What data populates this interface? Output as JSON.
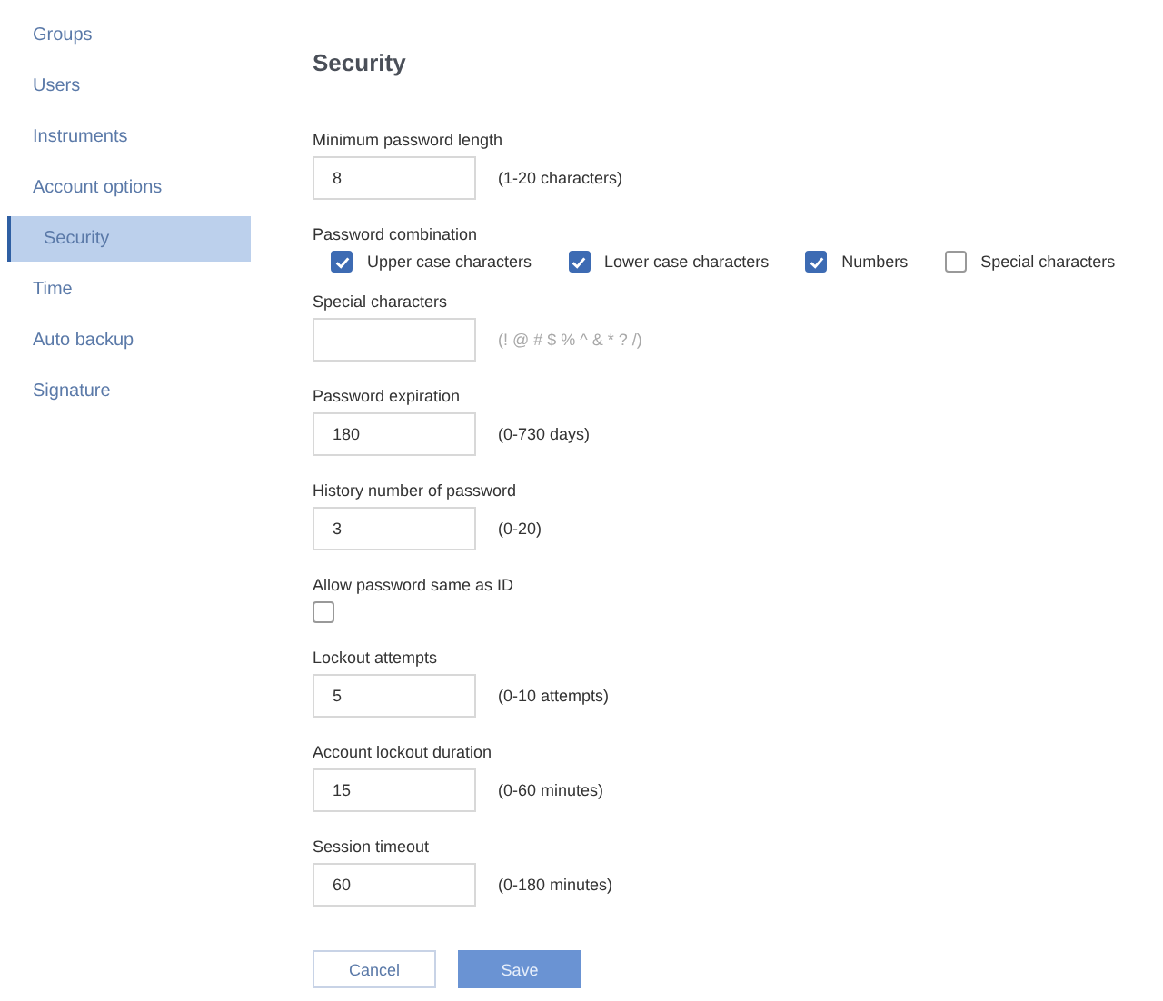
{
  "sidebar": {
    "items": [
      {
        "label": "Groups",
        "selected": false
      },
      {
        "label": "Users",
        "selected": false
      },
      {
        "label": "Instruments",
        "selected": false
      },
      {
        "label": "Account options",
        "selected": false
      },
      {
        "label": "Security",
        "selected": true
      },
      {
        "label": "Time",
        "selected": false
      },
      {
        "label": "Auto backup",
        "selected": false
      },
      {
        "label": "Signature",
        "selected": false
      }
    ]
  },
  "title": "Security",
  "fields": [
    {
      "kind": "input",
      "label": "Minimum password length",
      "value": "8",
      "hint": "(1-20 characters)"
    },
    {
      "kind": "checkgroup",
      "label": "Password combination",
      "options": [
        {
          "label": "Upper case characters",
          "checked": true
        },
        {
          "label": "Lower case characters",
          "checked": true
        },
        {
          "label": "Numbers",
          "checked": true
        },
        {
          "label": "Special characters",
          "checked": false
        }
      ]
    },
    {
      "kind": "input",
      "label": "Special characters",
      "hint": "(! @ # $ % ^ & * ? /)",
      "hint_muted": true
    },
    {
      "kind": "input",
      "label": "Password expiration",
      "value": "180",
      "hint": "(0-730 days)"
    },
    {
      "kind": "input",
      "label": "History number of password",
      "value": "3",
      "hint": "(0-20)"
    },
    {
      "kind": "checkbox",
      "label": "Allow password same as ID",
      "checked": false
    },
    {
      "kind": "input",
      "label": "Lockout attempts",
      "value": "5",
      "hint": "(0-10 attempts)"
    },
    {
      "kind": "input",
      "label": "Account lockout duration",
      "value": "15",
      "hint": "(0-60 minutes)"
    },
    {
      "kind": "input",
      "label": "Session timeout",
      "value": "60",
      "hint": "(0-180 minutes)"
    }
  ],
  "buttons": [
    {
      "label": "Cancel",
      "kind": "secondary"
    },
    {
      "label": "Save",
      "kind": "primary"
    }
  ]
}
